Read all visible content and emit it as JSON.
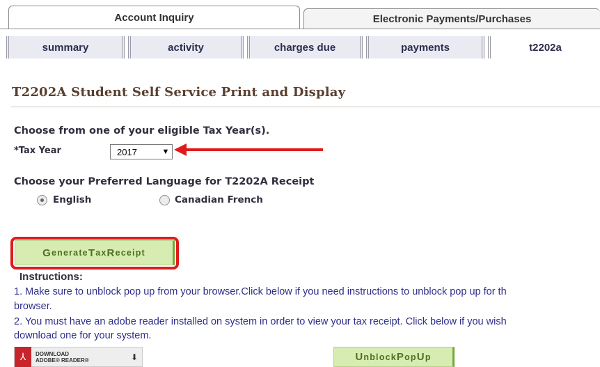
{
  "top_tabs": [
    {
      "label": "Account Inquiry",
      "active": true
    },
    {
      "label": "Electronic Payments/Purchases",
      "active": false
    }
  ],
  "sub_tabs": [
    "summary",
    "activity",
    "charges due",
    "payments",
    "t2202a"
  ],
  "page": {
    "title": "T2202A Student Self Service Print and Display",
    "choose_year": "Choose from one of your eligible Tax Year(s).",
    "tax_year_label": "*Tax Year",
    "tax_year_value": "2017",
    "choose_language": "Choose your Preferred Language for T2202A Receipt",
    "lang_english": "English",
    "lang_french": "Canadian French",
    "selected_language": "English"
  },
  "buttons": {
    "generate": {
      "first": "G",
      "rest1": "enerate ",
      "t": "T",
      "rest2": "ax ",
      "r": "R",
      "rest3": "eceipt"
    },
    "unblock": {
      "u": "U",
      "rest1": "nblock ",
      "p1": "P",
      "rest2": "op ",
      "u2": "U",
      "rest3": "p"
    }
  },
  "instructions": {
    "heading": "Instructions:",
    "line1": "1. Make sure to unblock pop up from your browser.Click below if you need instructions to unblock pop up for th",
    "line1b": "browser.",
    "line2": "2. You must have an adobe reader installed on system in order to view your tax receipt. Click below if you wish",
    "line2b": "download one for your system."
  },
  "adobe": {
    "line1": "DOWNLOAD",
    "line2": "ADOBE® READER®",
    "logo": "pdf-icon"
  },
  "colors": {
    "highlight": "#e01b1b",
    "button_bg": "#d7ecb0",
    "title": "#5a3f2f"
  }
}
